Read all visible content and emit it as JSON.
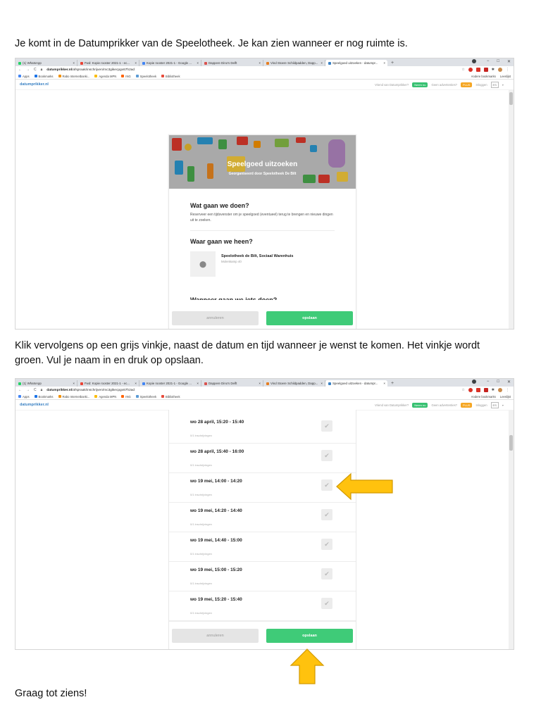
{
  "instructions": {
    "intro": "Je komt in de Datumprikker van de Speelotheek. Je kan zien wanneer er nog ruimte is.",
    "step2": "Klik vervolgens op een grijs vinkje, naast de datum en tijd wanneer je wenst te komen. Het vinkje wordt groen. Vul je naam in en druk op opslaan.",
    "closing": "Graag tot ziens!"
  },
  "browser": {
    "tabs": [
      {
        "label": "(1) WhatsApp",
        "color": "#25d366"
      },
      {
        "label": "Fwd: Kopie rooster 2021-1 - ec...",
        "color": "#ea4335"
      },
      {
        "label": "Kopie rooster 2021-1 - Google ...",
        "color": "#4285f4"
      },
      {
        "label": "Dappere Dino's Delft",
        "color": "#d9534f"
      },
      {
        "label": "Vind Stoere Schildpadden, Dapp...",
        "color": "#e67e22"
      },
      {
        "label": "Speelgoed uitzoeken - datumpr...",
        "color": "#3b82c4"
      }
    ],
    "url_domain": "datumprikker.nl",
    "url_path": "/afspraak/inschrijven/mc3gikecpgx67h2ad",
    "bookmarks": [
      {
        "label": "Apps",
        "color": "#4285f4"
      },
      {
        "label": "Bookmarks",
        "color": "#1a73e8"
      },
      {
        "label": "Rabo Internetbanki...",
        "color": "#f29100"
      },
      {
        "label": "Agenda MPN",
        "color": "#fbbc05"
      },
      {
        "label": "ING",
        "color": "#ff6200"
      },
      {
        "label": "Speelotheek",
        "color": "#5b9bd5"
      },
      {
        "label": "Bibliotheek",
        "color": "#e74c3c"
      }
    ],
    "bookmarks_right": [
      "Andere bookmarks",
      "Leeslijst"
    ]
  },
  "site": {
    "logo": "datumprikker.nl",
    "header_question1": "Vriend van Datumprikker?",
    "header_btn1": "Neem nu",
    "header_question2": "Geen advertenties?",
    "header_btn2": "PLUS",
    "header_login": "Inloggen",
    "lang": "ES"
  },
  "event": {
    "title": "Speelgoed uitzoeken",
    "organizer": "Georganiseerd door Speelotheek De Bilt",
    "what_heading": "Wat gaan we doen?",
    "what_text": "Reserveer een tijdsvenster om je speelgoed (eventueel) terug te brengen en nieuwe dingen uit te zoeken.",
    "where_heading": "Waar gaan we heen?",
    "location_name": "Speelotheek de Bilt, Sociaal Warenhuis",
    "location_address": "Molenkamp 40",
    "next_heading_cut": "Wanneer gaan we iets doen?"
  },
  "buttons": {
    "cancel": "annuleren",
    "save": "opslaan"
  },
  "slots": [
    {
      "time": "wo 28 april, 15:20 - 15:40",
      "count": "0/1 inschrijvingen"
    },
    {
      "time": "wo 28 april, 15:40 - 16:00",
      "count": "0/1 inschrijvingen"
    },
    {
      "time": "wo 19 mei, 14:00 - 14:20",
      "count": "0/1 inschrijvingen"
    },
    {
      "time": "wo 19 mei, 14:20 - 14:40",
      "count": "0/1 inschrijvingen"
    },
    {
      "time": "wo 19 mei, 14:40 - 15:00",
      "count": "0/1 inschrijvingen"
    },
    {
      "time": "wo 19 mei, 15:00 - 15:20",
      "count": "0/1 inschrijvingen"
    },
    {
      "time": "wo 19 mei, 15:20 - 15:40",
      "count": "0/1 inschrijvingen"
    }
  ],
  "colors": {
    "green": "#3fcb78",
    "arrow_fill": "#ffc20e",
    "arrow_stroke": "#d39a00",
    "link_blue": "#3b82c4"
  }
}
